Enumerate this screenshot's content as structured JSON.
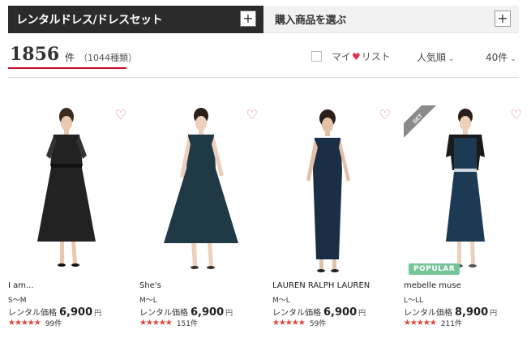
{
  "tabs": {
    "rental_label": "レンタルドレス/ドレスセット",
    "purchase_label": "購入商品を選ぶ",
    "expand_symbol": "+"
  },
  "results": {
    "count": "1856",
    "unit": "件",
    "kinds": "（1044種類）"
  },
  "controls": {
    "mylist_prefix": "マイ",
    "mylist_suffix": "リスト",
    "sort_label": "人気順",
    "per_page_label": "40件"
  },
  "products": [
    {
      "name": "I am...",
      "size": "S〜M",
      "price_label": "レンタル価格",
      "price": "6,900",
      "yen": "円",
      "stars": "★★★★★",
      "reviews": "99件",
      "dress_color": "#222222"
    },
    {
      "name": "She's",
      "size": "M〜L",
      "price_label": "レンタル価格",
      "price": "6,900",
      "yen": "円",
      "stars": "★★★★★",
      "reviews": "151件",
      "dress_color": "#1f3a44"
    },
    {
      "name": "LAUREN RALPH LAUREN",
      "size": "M〜L",
      "price_label": "レンタル価格",
      "price": "6,900",
      "yen": "円",
      "stars": "★★★★★",
      "reviews": "59件",
      "dress_color": "#1a2f45"
    },
    {
      "name": "mebelle muse",
      "size": "L〜LL",
      "price_label": "レンタル価格",
      "price": "8,900",
      "yen": "円",
      "stars": "★★★★★",
      "reviews": "211件",
      "dress_color": "#1d3a55",
      "badge": "POPULAR",
      "ribbon": "SET"
    }
  ]
}
